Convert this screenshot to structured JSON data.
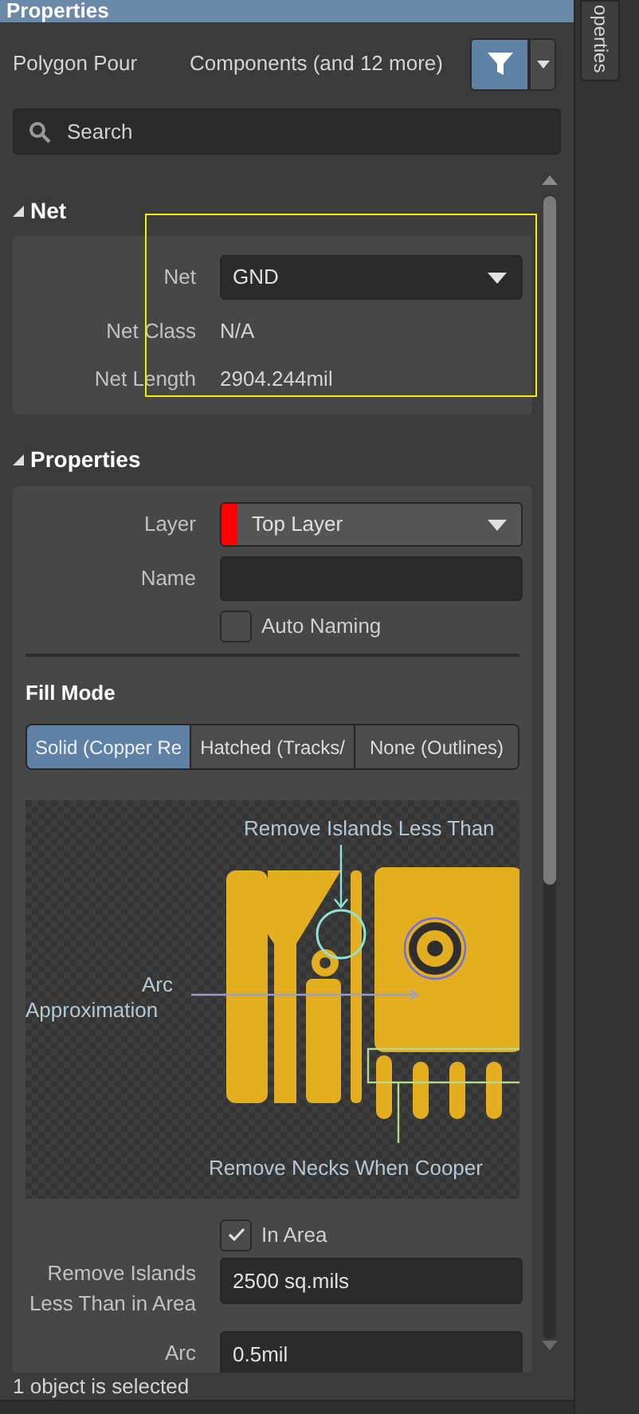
{
  "panel": {
    "title": "Properties"
  },
  "side_tab": {
    "label": "operties"
  },
  "header": {
    "object_type": "Polygon Pour",
    "filter_label": "Components (and 12 more)"
  },
  "search": {
    "placeholder": "Search"
  },
  "net_section": {
    "title": "Net",
    "expanded": true,
    "rows": [
      {
        "kind": "dropdown",
        "label": "Net",
        "value": "GND"
      },
      {
        "kind": "text",
        "label": "Net Class",
        "value": "N/A"
      },
      {
        "kind": "text",
        "label": "Net Length",
        "value": "2904.244mil"
      }
    ]
  },
  "properties_section": {
    "title": "Properties",
    "expanded": true,
    "layer": {
      "label": "Layer",
      "value": "Top Layer",
      "color": "#ff0000"
    },
    "name": {
      "label": "Name"
    },
    "auto_naming": {
      "label": "Auto Naming",
      "checked": false
    },
    "fill_mode": {
      "title": "Fill Mode",
      "options": [
        {
          "label": "Solid (Copper Re",
          "selected": true
        },
        {
          "label": "Hatched (Tracks/",
          "selected": false
        },
        {
          "label": "None (Outlines)",
          "selected": false
        }
      ]
    },
    "diagram": {
      "islands_label": "Remove Islands Less Than",
      "arc_label_1": "Arc",
      "arc_label_2": "Approximation",
      "necks_label": "Remove Necks When Cooper"
    },
    "in_area": {
      "label": "In Area",
      "checked": true
    },
    "remove_islands": {
      "label": "Remove Islands Less Than in Area",
      "value": "2500 sq.mils"
    },
    "arc": {
      "label": "Arc",
      "value": "0.5mil"
    }
  },
  "status_bar": {
    "text": "1 object is selected"
  }
}
